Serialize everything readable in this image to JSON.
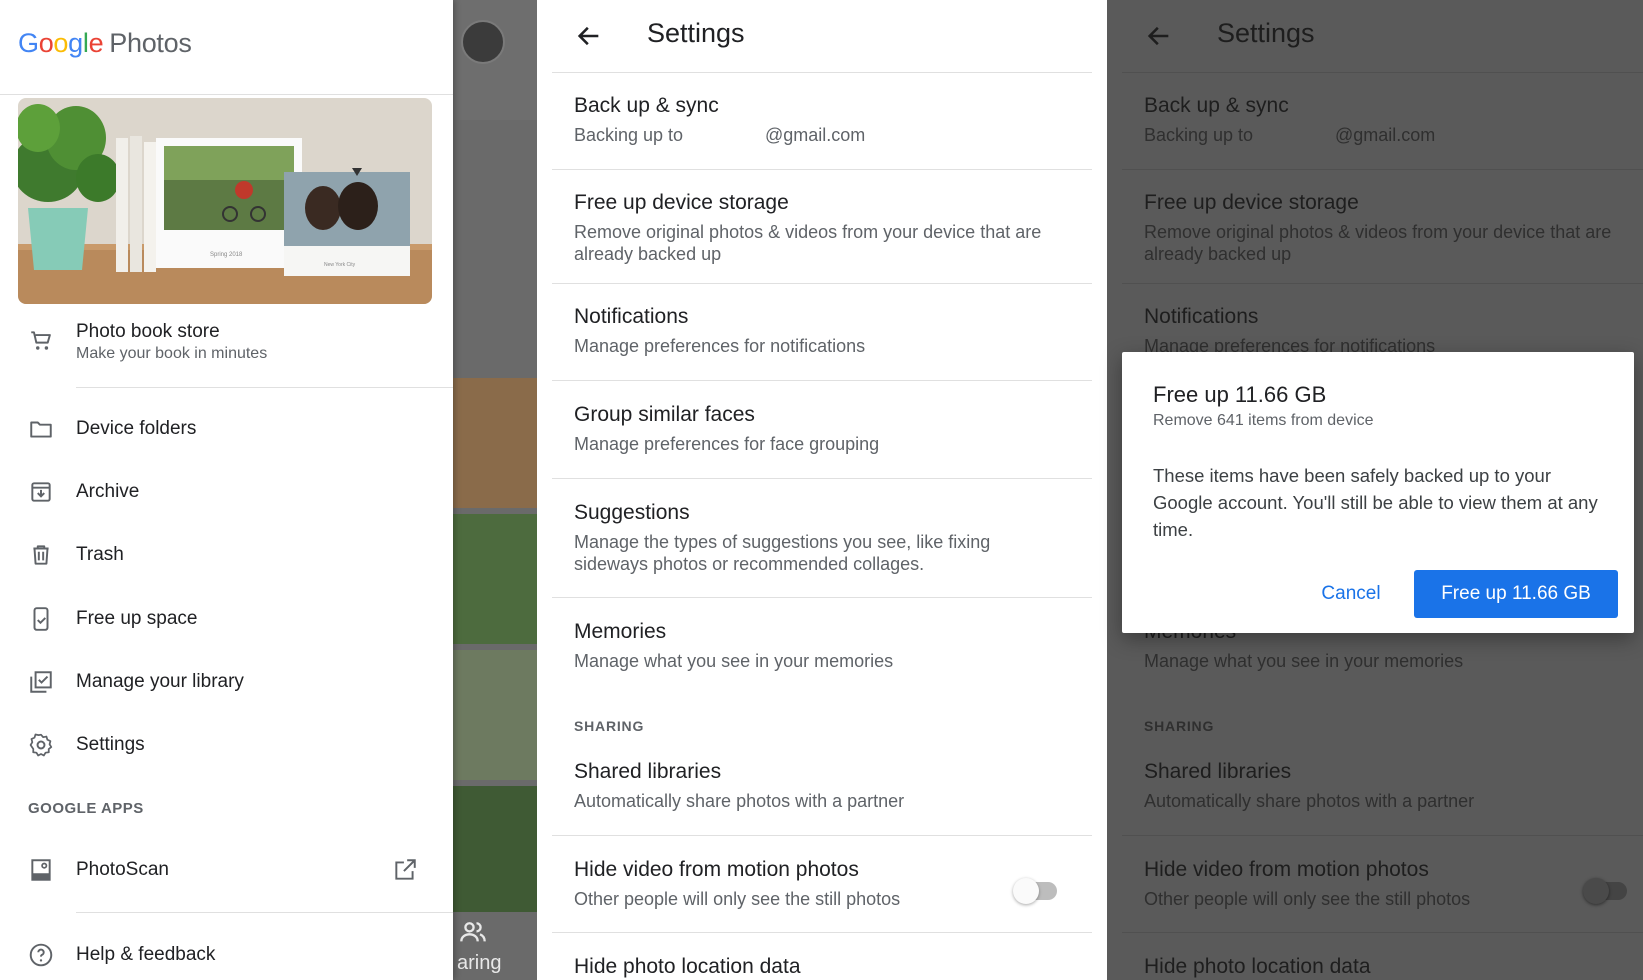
{
  "drawer": {
    "logo": {
      "letters": [
        "G",
        "o",
        "o",
        "g",
        "l",
        "e"
      ],
      "product": "Photos"
    },
    "promo": {
      "book1_text": "Spring 2018",
      "book2_text": "New York City"
    },
    "photo_book_store": {
      "title": "Photo book store",
      "subtitle": "Make your book in minutes"
    },
    "items": [
      {
        "label": "Device folders",
        "icon": "folder-icon"
      },
      {
        "label": "Archive",
        "icon": "archive-icon"
      },
      {
        "label": "Trash",
        "icon": "trash-icon"
      },
      {
        "label": "Free up space",
        "icon": "free-up-space-icon"
      },
      {
        "label": "Manage your library",
        "icon": "manage-library-icon"
      },
      {
        "label": "Settings",
        "icon": "gear-icon"
      }
    ],
    "google_apps_header": "GOOGLE APPS",
    "photoscan": {
      "label": "PhotoScan",
      "icon": "photoscan-icon",
      "trailing_icon": "open-in-new-icon"
    },
    "help": {
      "label": "Help & feedback",
      "icon": "help-icon"
    }
  },
  "background": {
    "sharing_label": "aring"
  },
  "settings": {
    "title": "Settings",
    "backup": {
      "title": "Back up & sync",
      "subtitle_prefix": "Backing up to",
      "subtitle_email": "@gmail.com"
    },
    "free_up": {
      "title": "Free up device storage",
      "subtitle": "Remove original photos & videos from your device that are already backed up"
    },
    "notifications": {
      "title": "Notifications",
      "subtitle": "Manage preferences for notifications"
    },
    "faces": {
      "title": "Group similar faces",
      "subtitle": "Manage preferences for face grouping"
    },
    "suggestions": {
      "title": "Suggestions",
      "subtitle": "Manage the types of suggestions you see, like fixing sideways photos or recommended collages."
    },
    "memories": {
      "title": "Memories",
      "subtitle": "Manage what you see in your memories"
    },
    "sharing_header": "SHARING",
    "shared_libraries": {
      "title": "Shared libraries",
      "subtitle": "Automatically share photos with a partner"
    },
    "hide_video": {
      "title": "Hide video from motion photos",
      "subtitle": "Other people will only see the still photos",
      "enabled": false
    },
    "hide_location": {
      "title": "Hide photo location data"
    }
  },
  "dialog": {
    "title": "Free up 11.66 GB",
    "subtitle": "Remove 641 items from device",
    "body": "These items have been safely backed up to your Google account. You'll still be able to view them at any time.",
    "cancel_label": "Cancel",
    "confirm_label": "Free up 11.66 GB"
  },
  "colors": {
    "accent": "#1a73e8",
    "scrim": "#5a5a5a"
  }
}
